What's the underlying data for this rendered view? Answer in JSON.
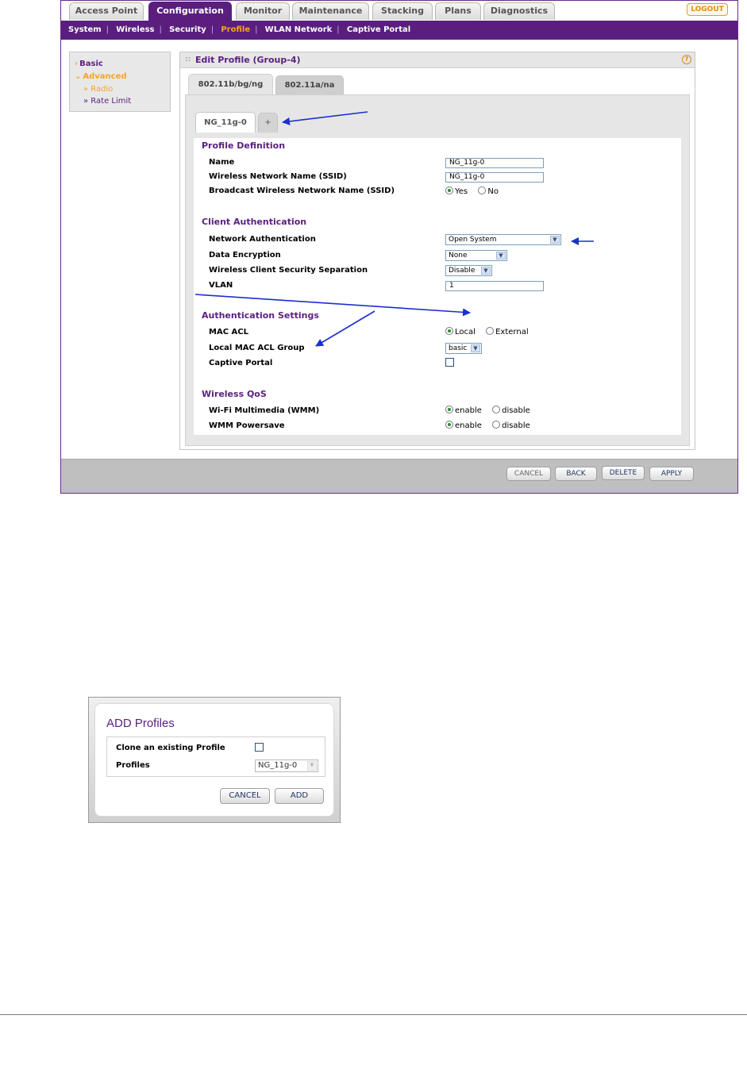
{
  "top_tabs": [
    "Access Point",
    "Configuration",
    "Monitor",
    "Maintenance",
    "Stacking",
    "Plans",
    "Diagnostics"
  ],
  "active_top_tab": "Configuration",
  "logout_label": "LOGOUT",
  "subnav": [
    "System",
    "Wireless",
    "Security",
    "Profile",
    "WLAN Network",
    "Captive Portal"
  ],
  "active_subnav": "Profile",
  "left_menu": {
    "basic": "Basic",
    "advanced": "Advanced",
    "radio": "» Radio",
    "rate_limit": "» Rate Limit"
  },
  "panel_title": "Edit Profile (Group-4)",
  "band_tabs": [
    "802.11b/bg/ng",
    "802.11a/na"
  ],
  "profile_tabs": [
    "NG_11g-0",
    "+"
  ],
  "sections": {
    "profile_definition": {
      "title": "Profile Definition",
      "name_label": "Name",
      "name_value": "NG_11g-0",
      "ssid_label": "Wireless Network Name (SSID)",
      "ssid_value": "NG_11g-0",
      "broadcast_label": "Broadcast Wireless Network Name (SSID)",
      "yes": "Yes",
      "no": "No"
    },
    "client_auth": {
      "title": "Client Authentication",
      "net_auth_label": "Network Authentication",
      "net_auth_value": "Open System",
      "encryption_label": "Data Encryption",
      "encryption_value": "None",
      "separation_label": "Wireless Client Security Separation",
      "separation_value": "Disable",
      "vlan_label": "VLAN",
      "vlan_value": "1"
    },
    "auth_settings": {
      "title": "Authentication Settings",
      "mac_acl_label": "MAC ACL",
      "local": "Local",
      "external": "External",
      "mac_group_label": "Local MAC ACL Group",
      "mac_group_value": "basic",
      "captive_label": "Captive Portal"
    },
    "qos": {
      "title": "Wireless QoS",
      "wmm_label": "Wi-Fi Multimedia (WMM)",
      "powersave_label": "WMM Powersave",
      "enable": "enable",
      "disable": "disable"
    }
  },
  "footer_buttons": {
    "cancel": "CANCEL",
    "back": "BACK",
    "delete": "DELETE",
    "apply": "APPLY"
  },
  "dialog": {
    "title": "ADD Profiles",
    "clone_label": "Clone an existing Profile",
    "profiles_label": "Profiles",
    "profiles_value": "NG_11g-0",
    "cancel": "CANCEL",
    "add": "ADD"
  },
  "colors": {
    "brand_purple": "#5a1f7e",
    "accent_orange": "#f5a623",
    "annotation_blue": "#1a2fd0"
  }
}
